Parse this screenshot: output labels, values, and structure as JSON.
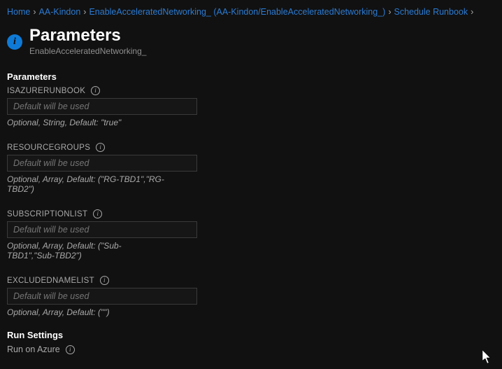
{
  "breadcrumb": {
    "items": [
      {
        "label": "Home"
      },
      {
        "label": "AA-Kindon"
      },
      {
        "label": "EnableAcceleratedNetworking_ (AA-Kindon/EnableAcceleratedNetworking_)"
      },
      {
        "label": "Schedule Runbook"
      }
    ]
  },
  "header": {
    "title": "Parameters",
    "subtitle": "EnableAcceleratedNetworking_"
  },
  "sections": {
    "parameters_heading": "Parameters",
    "run_settings_heading": "Run Settings"
  },
  "fields": {
    "isazurerunbook": {
      "label": "ISAZURERUNBOOK",
      "placeholder": "Default will be used",
      "help": "Optional, String, Default: \"true\""
    },
    "resourcegroups": {
      "label": "RESOURCEGROUPS",
      "placeholder": "Default will be used",
      "help": "Optional, Array, Default: (\"RG-TBD1\",\"RG-TBD2\")"
    },
    "subscriptionlist": {
      "label": "SUBSCRIPTIONLIST",
      "placeholder": "Default will be used",
      "help": "Optional, Array, Default: (\"Sub-TBD1\",\"Sub-TBD2\")"
    },
    "excludednamelist": {
      "label": "EXCLUDEDNAMELIST",
      "placeholder": "Default will be used",
      "help": "Optional, Array, Default: (\"\")"
    }
  },
  "run_settings": {
    "mode_label": "Run on Azure"
  },
  "glyphs": {
    "info": "i",
    "chevron": "›"
  }
}
